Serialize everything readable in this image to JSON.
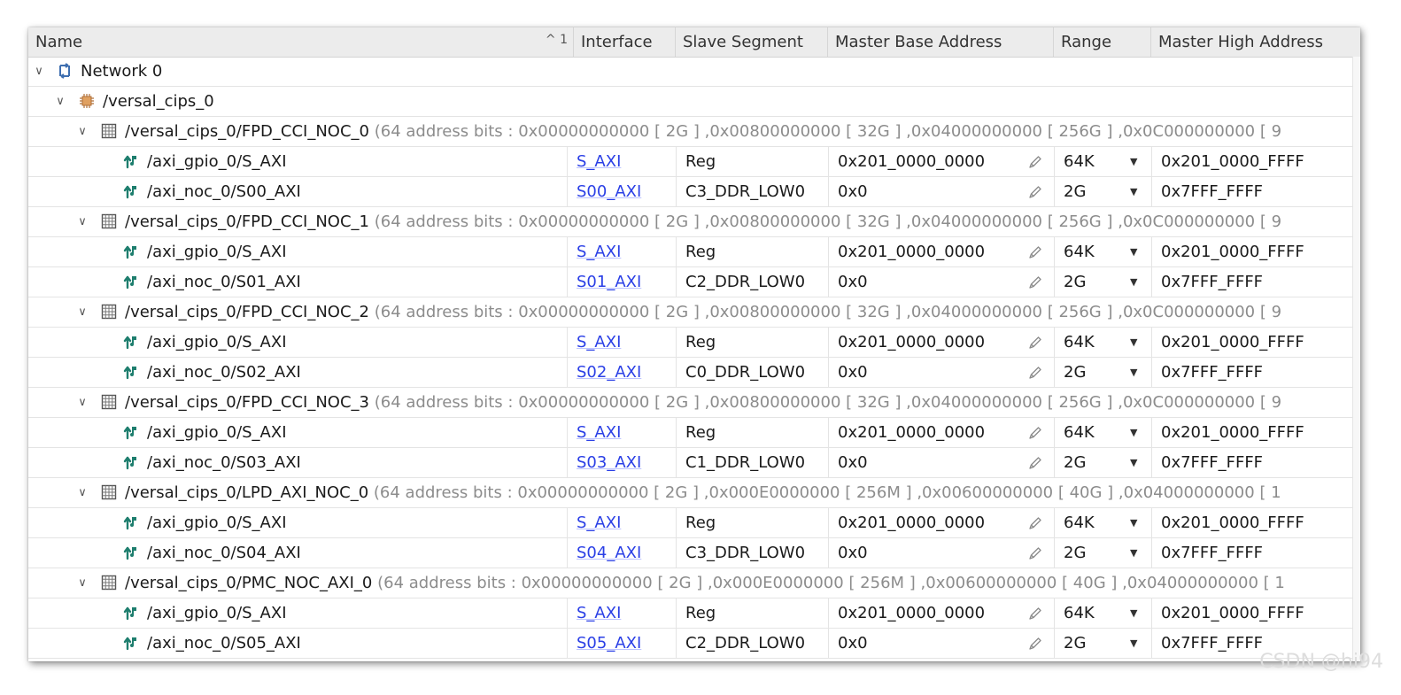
{
  "columns": {
    "name": "Name",
    "sort_indicator": "^ 1",
    "interface": "Interface",
    "slave_segment": "Slave Segment",
    "master_base": "Master Base Address",
    "range": "Range",
    "master_high": "Master High Address"
  },
  "network": {
    "label": "Network 0"
  },
  "cips": {
    "label": "/versal_cips_0"
  },
  "groups": [
    {
      "label": "/versal_cips_0/FPD_CCI_NOC_0",
      "desc": "(64 address bits : 0x00000000000 [ 2G ] ,0x00800000000 [ 32G ] ,0x04000000000 [ 256G ] ,0x0C000000000 [ 9",
      "items": [
        {
          "name": "/axi_gpio_0/S_AXI",
          "interface": "S_AXI",
          "segment": "Reg",
          "base": "0x201_0000_0000",
          "range": "64K",
          "high": "0x201_0000_FFFF"
        },
        {
          "name": "/axi_noc_0/S00_AXI",
          "interface": "S00_AXI",
          "segment": "C3_DDR_LOW0",
          "base": "0x0",
          "range": "2G",
          "high": "0x7FFF_FFFF"
        }
      ]
    },
    {
      "label": "/versal_cips_0/FPD_CCI_NOC_1",
      "desc": "(64 address bits : 0x00000000000 [ 2G ] ,0x00800000000 [ 32G ] ,0x04000000000 [ 256G ] ,0x0C000000000 [ 9",
      "items": [
        {
          "name": "/axi_gpio_0/S_AXI",
          "interface": "S_AXI",
          "segment": "Reg",
          "base": "0x201_0000_0000",
          "range": "64K",
          "high": "0x201_0000_FFFF"
        },
        {
          "name": "/axi_noc_0/S01_AXI",
          "interface": "S01_AXI",
          "segment": "C2_DDR_LOW0",
          "base": "0x0",
          "range": "2G",
          "high": "0x7FFF_FFFF"
        }
      ]
    },
    {
      "label": "/versal_cips_0/FPD_CCI_NOC_2",
      "desc": "(64 address bits : 0x00000000000 [ 2G ] ,0x00800000000 [ 32G ] ,0x04000000000 [ 256G ] ,0x0C000000000 [ 9",
      "items": [
        {
          "name": "/axi_gpio_0/S_AXI",
          "interface": "S_AXI",
          "segment": "Reg",
          "base": "0x201_0000_0000",
          "range": "64K",
          "high": "0x201_0000_FFFF"
        },
        {
          "name": "/axi_noc_0/S02_AXI",
          "interface": "S02_AXI",
          "segment": "C0_DDR_LOW0",
          "base": "0x0",
          "range": "2G",
          "high": "0x7FFF_FFFF"
        }
      ]
    },
    {
      "label": "/versal_cips_0/FPD_CCI_NOC_3",
      "desc": "(64 address bits : 0x00000000000 [ 2G ] ,0x00800000000 [ 32G ] ,0x04000000000 [ 256G ] ,0x0C000000000 [ 9",
      "items": [
        {
          "name": "/axi_gpio_0/S_AXI",
          "interface": "S_AXI",
          "segment": "Reg",
          "base": "0x201_0000_0000",
          "range": "64K",
          "high": "0x201_0000_FFFF"
        },
        {
          "name": "/axi_noc_0/S03_AXI",
          "interface": "S03_AXI",
          "segment": "C1_DDR_LOW0",
          "base": "0x0",
          "range": "2G",
          "high": "0x7FFF_FFFF"
        }
      ]
    },
    {
      "label": "/versal_cips_0/LPD_AXI_NOC_0",
      "desc": "(64 address bits : 0x00000000000 [ 2G ] ,0x000E0000000 [ 256M ] ,0x00600000000 [ 40G ] ,0x04000000000 [ 1",
      "items": [
        {
          "name": "/axi_gpio_0/S_AXI",
          "interface": "S_AXI",
          "segment": "Reg",
          "base": "0x201_0000_0000",
          "range": "64K",
          "high": "0x201_0000_FFFF"
        },
        {
          "name": "/axi_noc_0/S04_AXI",
          "interface": "S04_AXI",
          "segment": "C3_DDR_LOW0",
          "base": "0x0",
          "range": "2G",
          "high": "0x7FFF_FFFF"
        }
      ]
    },
    {
      "label": "/versal_cips_0/PMC_NOC_AXI_0",
      "desc": "(64 address bits : 0x00000000000 [ 2G ] ,0x000E0000000 [ 256M ] ,0x00600000000 [ 40G ] ,0x04000000000 [ 1",
      "items": [
        {
          "name": "/axi_gpio_0/S_AXI",
          "interface": "S_AXI",
          "segment": "Reg",
          "base": "0x201_0000_0000",
          "range": "64K",
          "high": "0x201_0000_FFFF"
        },
        {
          "name": "/axi_noc_0/S05_AXI",
          "interface": "S05_AXI",
          "segment": "C2_DDR_LOW0",
          "base": "0x0",
          "range": "2G",
          "high": "0x7FFF_FFFF"
        }
      ]
    }
  ],
  "watermark": "CSDN @hi94",
  "icons": {
    "network": "network-icon",
    "cips": "processor-icon",
    "group": "address-space-icon",
    "item": "slave-interface-icon",
    "edit": "pencil-icon",
    "dropdown": "caret-down-icon"
  },
  "colors": {
    "link": "#2a3fe6",
    "header_bg": "#ececec",
    "icon_teal": "#1e7e6e",
    "desc": "#8c8c8c"
  }
}
